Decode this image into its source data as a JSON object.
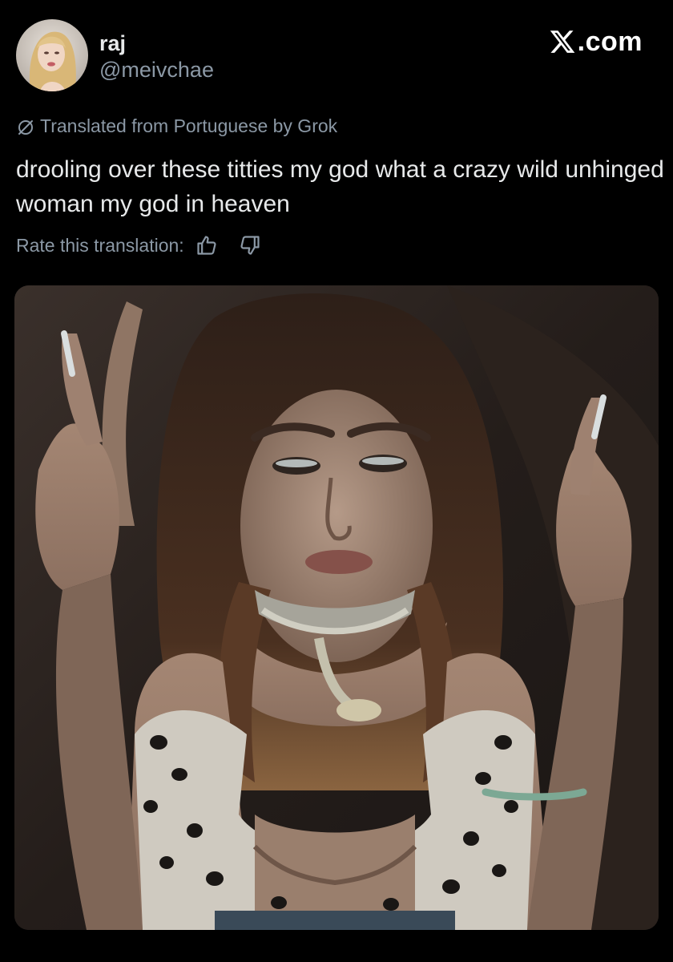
{
  "author": {
    "display_name": "raj",
    "handle": "@meivchae",
    "avatar_icon": "profile-photo"
  },
  "brand": {
    "text": ".com",
    "icon": "x-logo-icon"
  },
  "translation": {
    "label": "Translated from Portuguese by Grok",
    "icon": "translate-slash-icon"
  },
  "tweet": {
    "text": "drooling over these titties my god what a crazy wild unhinged woman my god in heaven"
  },
  "rating": {
    "label": "Rate this translation:",
    "up_icon": "thumbs-up-icon",
    "down_icon": "thumbs-down-icon"
  },
  "media": {
    "type": "photo"
  },
  "colors": {
    "background": "#000000",
    "text_primary": "#e7e9ea",
    "text_secondary": "#8b98a5"
  }
}
